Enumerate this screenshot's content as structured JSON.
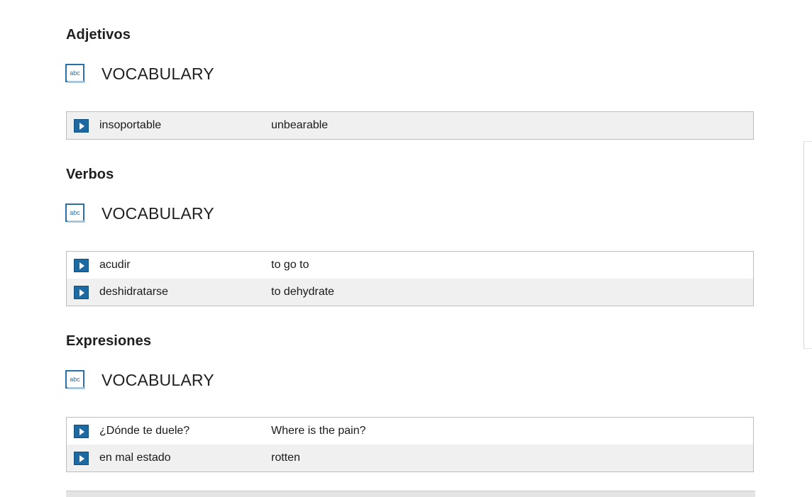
{
  "sections": [
    {
      "heading": "Adjetivos",
      "vocab_title": "VOCABULARY",
      "icon": "abc-book-icon",
      "rows": [
        {
          "term": "insoportable",
          "translation": "unbearable"
        }
      ]
    },
    {
      "heading": "Verbos",
      "vocab_title": "VOCABULARY",
      "icon": "abc-book-icon",
      "rows": [
        {
          "term": "acudir",
          "translation": "to go to"
        },
        {
          "term": "deshidratarse",
          "translation": "to dehydrate"
        }
      ]
    },
    {
      "heading": "Expresiones",
      "vocab_title": "VOCABULARY",
      "icon": "abc-book-icon",
      "rows": [
        {
          "term": "¿Dónde te duele?",
          "translation": "Where is the pain?"
        },
        {
          "term": "en mal estado",
          "translation": "rotten"
        }
      ]
    }
  ],
  "icon_text": "abc",
  "colors": {
    "play_button": "#1d6aa3",
    "row_alt": "#f0f0f0",
    "border": "#bdbdbd"
  }
}
